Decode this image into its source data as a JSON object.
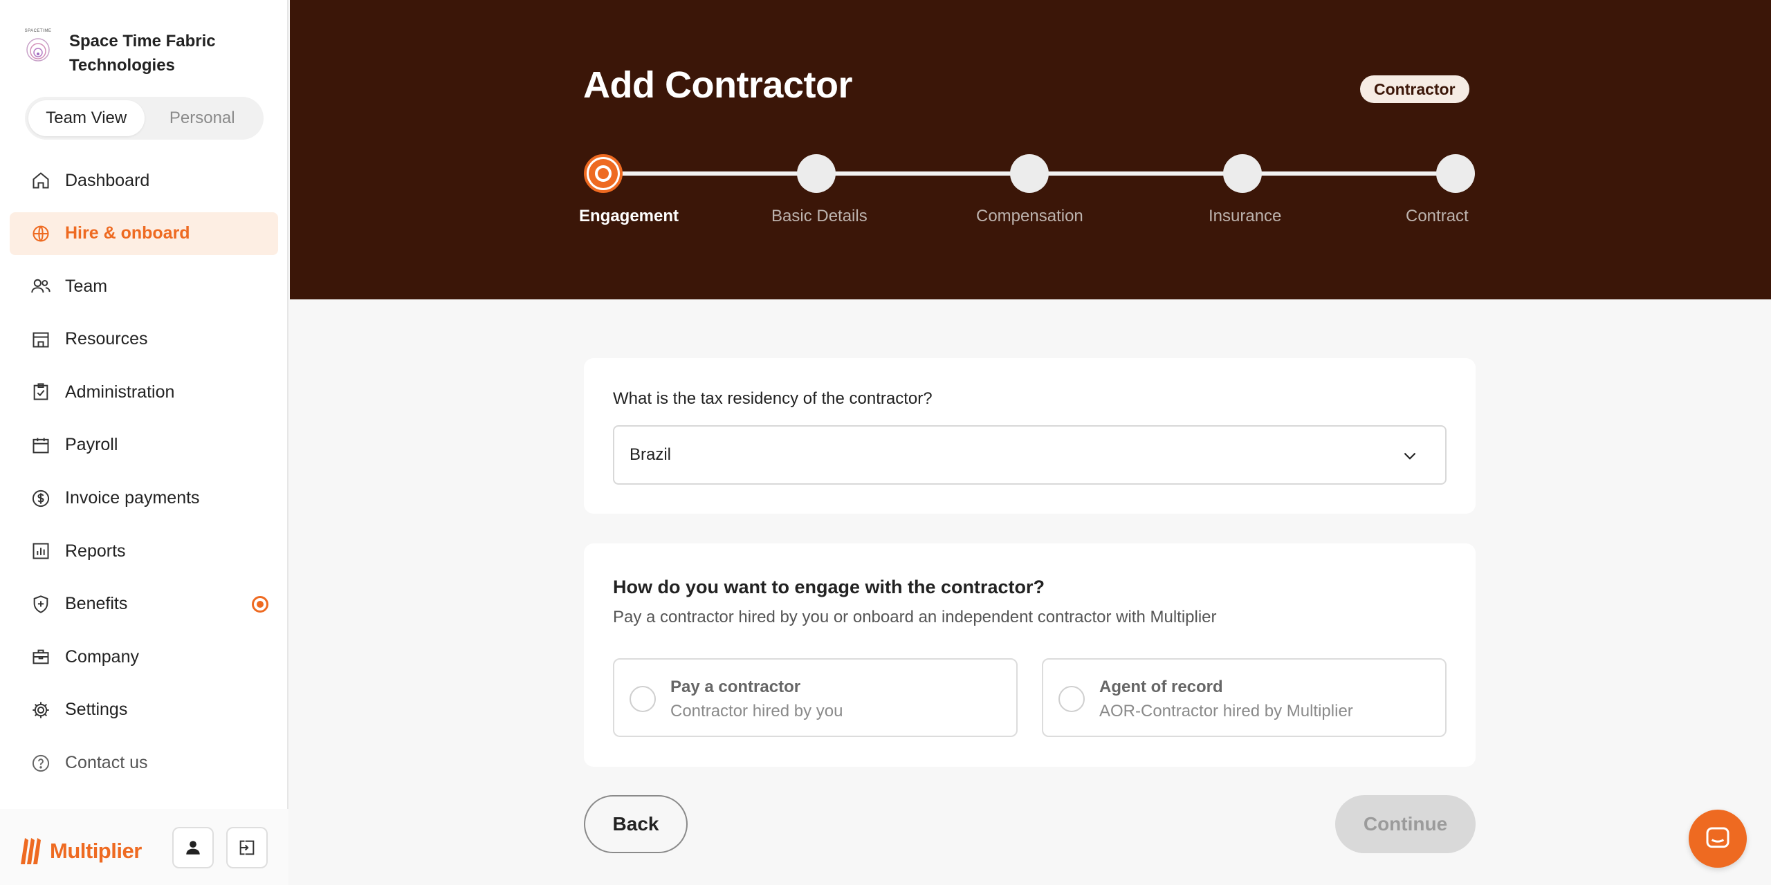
{
  "org": {
    "logo_text": "SPACETIME",
    "name": "Space Time Fabric Technologies"
  },
  "view_toggle": {
    "team": "Team View",
    "personal": "Personal",
    "selected": "Team View"
  },
  "nav": {
    "items": [
      {
        "label": "Dashboard",
        "icon": "home-icon"
      },
      {
        "label": "Hire & onboard",
        "icon": "globe-icon",
        "active": true
      },
      {
        "label": "Team",
        "icon": "people-icon"
      },
      {
        "label": "Resources",
        "icon": "storefront-icon"
      },
      {
        "label": "Administration",
        "icon": "clipboard-check-icon"
      },
      {
        "label": "Payroll",
        "icon": "calendar-icon"
      },
      {
        "label": "Invoice payments",
        "icon": "dollar-circle-icon"
      },
      {
        "label": "Reports",
        "icon": "bar-chart-icon"
      },
      {
        "label": "Benefits",
        "icon": "shield-plus-icon",
        "badge": true
      },
      {
        "label": "Company",
        "icon": "briefcase-icon"
      },
      {
        "label": "Settings",
        "icon": "gear-icon"
      },
      {
        "label": "Contact us",
        "icon": "help-circle-icon"
      }
    ]
  },
  "brand": {
    "name": "Multiplier",
    "color": "#ee6a21"
  },
  "header": {
    "title": "Add Contractor",
    "chip": "Contractor",
    "background": "#3b1608"
  },
  "stepper": {
    "steps": [
      "Engagement",
      "Basic Details",
      "Compensation",
      "Insurance",
      "Contract"
    ],
    "current": 0
  },
  "tax_residency": {
    "question": "What is the tax residency of the contractor?",
    "value": "Brazil"
  },
  "engagement": {
    "title": "How do you want to engage with the contractor?",
    "subtitle": "Pay a contractor hired by you or onboard an independent contractor with Multiplier",
    "options": [
      {
        "title": "Pay a contractor",
        "subtitle": "Contractor hired by you"
      },
      {
        "title": "Agent of record",
        "subtitle": "AOR-Contractor hired by Multiplier"
      }
    ]
  },
  "actions": {
    "back": "Back",
    "continue": "Continue"
  }
}
